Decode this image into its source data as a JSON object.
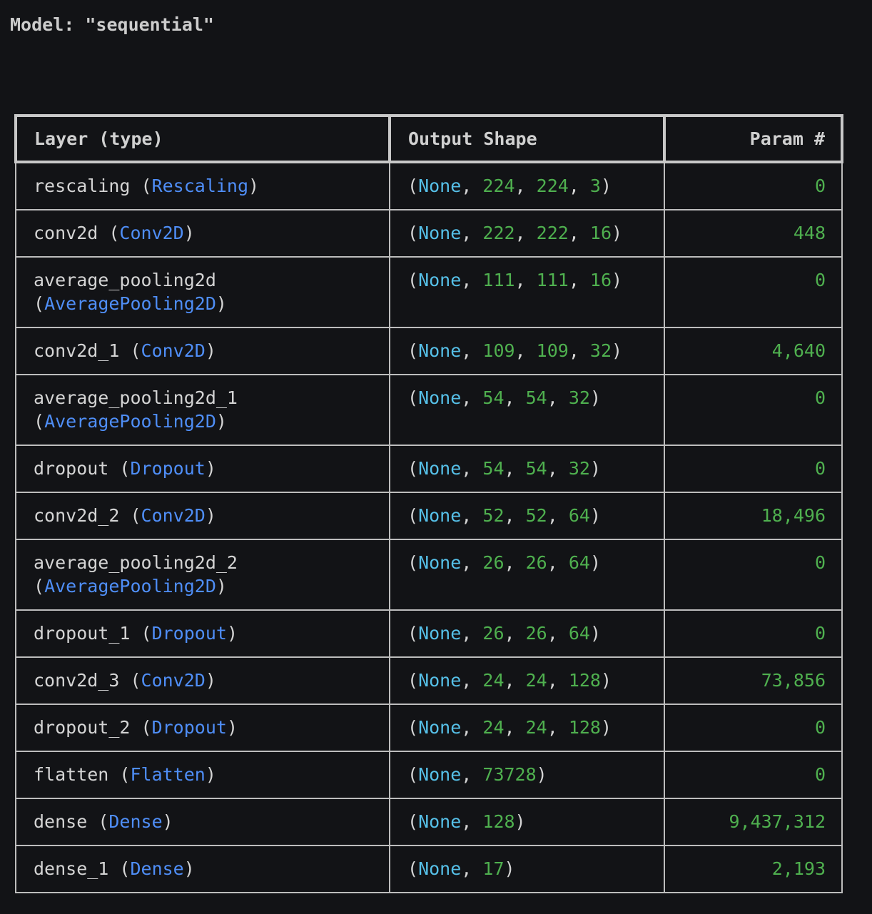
{
  "model_title": "Model: \"sequential\"",
  "table": {
    "headers": [
      "Layer (type)",
      "Output Shape",
      "Param #"
    ],
    "rows": [
      {
        "name": "rescaling",
        "class": "Rescaling",
        "wrap": false,
        "shape": [
          "224",
          "224",
          "3"
        ],
        "params": "0"
      },
      {
        "name": "conv2d",
        "class": "Conv2D",
        "wrap": false,
        "shape": [
          "222",
          "222",
          "16"
        ],
        "params": "448"
      },
      {
        "name": "average_pooling2d",
        "class": "AveragePooling2D",
        "wrap": true,
        "shape": [
          "111",
          "111",
          "16"
        ],
        "params": "0"
      },
      {
        "name": "conv2d_1",
        "class": "Conv2D",
        "wrap": false,
        "shape": [
          "109",
          "109",
          "32"
        ],
        "params": "4,640"
      },
      {
        "name": "average_pooling2d_1",
        "class": "AveragePooling2D",
        "wrap": true,
        "shape": [
          "54",
          "54",
          "32"
        ],
        "params": "0"
      },
      {
        "name": "dropout",
        "class": "Dropout",
        "wrap": false,
        "shape": [
          "54",
          "54",
          "32"
        ],
        "params": "0"
      },
      {
        "name": "conv2d_2",
        "class": "Conv2D",
        "wrap": false,
        "shape": [
          "52",
          "52",
          "64"
        ],
        "params": "18,496"
      },
      {
        "name": "average_pooling2d_2",
        "class": "AveragePooling2D",
        "wrap": true,
        "shape": [
          "26",
          "26",
          "64"
        ],
        "params": "0"
      },
      {
        "name": "dropout_1",
        "class": "Dropout",
        "wrap": false,
        "shape": [
          "26",
          "26",
          "64"
        ],
        "params": "0"
      },
      {
        "name": "conv2d_3",
        "class": "Conv2D",
        "wrap": false,
        "shape": [
          "24",
          "24",
          "128"
        ],
        "params": "73,856"
      },
      {
        "name": "dropout_2",
        "class": "Dropout",
        "wrap": false,
        "shape": [
          "24",
          "24",
          "128"
        ],
        "params": "0"
      },
      {
        "name": "flatten",
        "class": "Flatten",
        "wrap": false,
        "shape": [
          "73728"
        ],
        "params": "0"
      },
      {
        "name": "dense",
        "class": "Dense",
        "wrap": false,
        "shape": [
          "128"
        ],
        "params": "9,437,312"
      },
      {
        "name": "dense_1",
        "class": "Dense",
        "wrap": false,
        "shape": [
          "17"
        ],
        "params": "2,193"
      }
    ],
    "none_label": "None"
  },
  "colors": {
    "background": "#121316",
    "text": "#d4d4d4",
    "class_name": "#4f8ef7",
    "none": "#56c0e8",
    "number": "#4fb04f",
    "border": "#bdbdbd"
  }
}
